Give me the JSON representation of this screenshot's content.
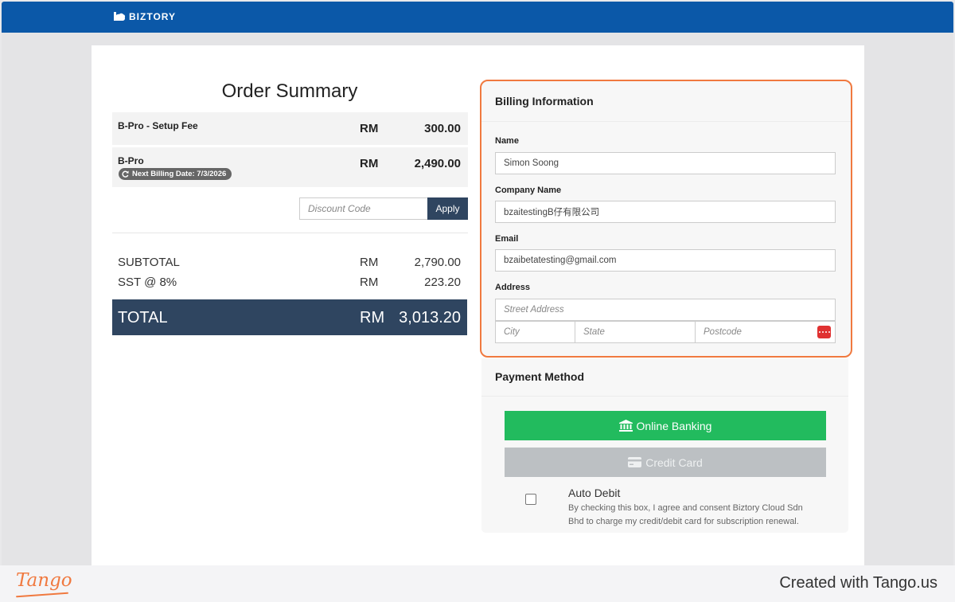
{
  "header": {
    "brand": "BIZTORY"
  },
  "order_summary": {
    "title": "Order Summary",
    "items": [
      {
        "name": "B-Pro - Setup Fee",
        "currency": "RM",
        "amount": "300.00"
      },
      {
        "name": "B-Pro",
        "currency": "RM",
        "amount": "2,490.00",
        "badge": "Next Billing Date: 7/3/2026"
      }
    ],
    "discount": {
      "placeholder": "Discount Code",
      "apply_label": "Apply"
    },
    "subtotal": {
      "label": "SUBTOTAL",
      "currency": "RM",
      "amount": "2,790.00"
    },
    "tax": {
      "label": "SST @ 8%",
      "currency": "RM",
      "amount": "223.20"
    },
    "total": {
      "label": "TOTAL",
      "currency": "RM",
      "amount": "3,013.20",
      "color": "#2f4560"
    }
  },
  "billing": {
    "title": "Billing Information",
    "highlight_color": "#f0793f",
    "name": {
      "label": "Name",
      "value": "Simon Soong"
    },
    "company": {
      "label": "Company Name",
      "value": "bzaitestingB仔有限公司"
    },
    "email": {
      "label": "Email",
      "value": "bzaibetatesting@gmail.com"
    },
    "address": {
      "label": "Address",
      "street_placeholder": "Street Address",
      "city_placeholder": "City",
      "state_placeholder": "State",
      "postcode_placeholder": "Postcode",
      "autofill_icon": "password-manager-icon"
    }
  },
  "payment": {
    "title": "Payment Method",
    "online_banking": {
      "label": "Online Banking",
      "icon": "bank-icon",
      "color": "#22bb5e"
    },
    "credit_card": {
      "label": "Credit Card",
      "icon": "credit-card-icon",
      "color": "#bcc0c3"
    },
    "auto_debit": {
      "title": "Auto Debit",
      "checked": false,
      "description": "By checking this box, I agree and consent Biztory Cloud Sdn Bhd to charge my credit/debit card for subscription renewal."
    }
  },
  "footer": {
    "logo": "Tango",
    "credit": "Created with Tango.us"
  }
}
